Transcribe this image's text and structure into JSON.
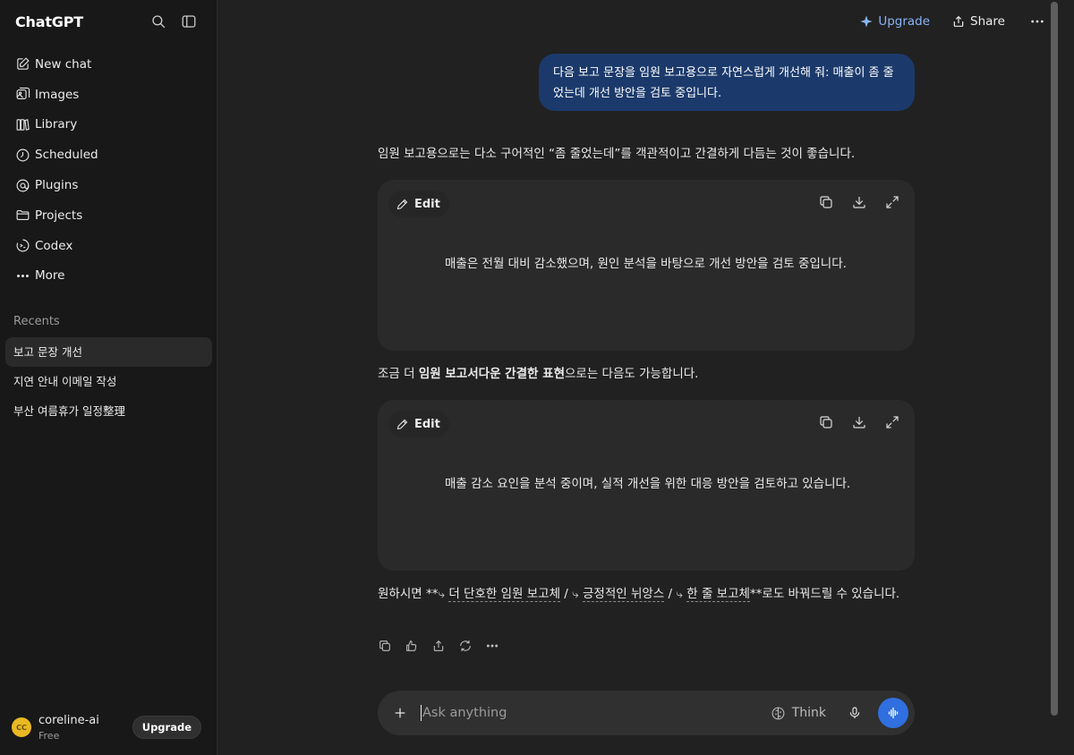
{
  "sidebar": {
    "logo": "ChatGPT",
    "nav": [
      {
        "label": "New chat",
        "icon": "edit-icon"
      },
      {
        "label": "Images",
        "icon": "images-icon"
      },
      {
        "label": "Library",
        "icon": "library-icon"
      },
      {
        "label": "Scheduled",
        "icon": "clock-icon"
      },
      {
        "label": "Plugins",
        "icon": "plugins-icon"
      },
      {
        "label": "Projects",
        "icon": "folder-icon"
      },
      {
        "label": "Codex",
        "icon": "codex-icon"
      },
      {
        "label": "More",
        "icon": "more-icon"
      }
    ],
    "recents_label": "Recents",
    "recents": [
      "보고 문장 개선",
      "지연 안내 이메일 작성",
      "부산 여름휴가 일정整理"
    ],
    "user": {
      "initials": "CC",
      "name": "coreline-ai",
      "plan": "Free",
      "upgrade": "Upgrade"
    }
  },
  "topbar": {
    "upgrade": "Upgrade",
    "share": "Share"
  },
  "conversation": {
    "user_message": "다음 보고 문장을 임원 보고용으로 자연스럽게 개선해 줘: 매출이 좀 줄었는데 개선 방안을 검토 중입니다.",
    "intro": "임원 보고용으로는 다소 구어적인 “좀 줄었는데”를 객관적이고 간결하게 다듬는 것이 좋습니다.",
    "card1": {
      "edit": "Edit",
      "text": "매출은 전월 대비 감소했으며, 원인 분석을 바탕으로 개선 방안을 검토 중입니다."
    },
    "middle_pre": "조금 더 ",
    "middle_bold": "임원 보고서다운 간결한 표현",
    "middle_post": "으로는 다음도 가능합니다.",
    "card2": {
      "edit": "Edit",
      "text": "매출 감소 요인을 분석 중이며, 실적 개선을 위한 대응 방안을 검토하고 있습니다."
    },
    "follow": {
      "pre": "원하시면 **",
      "arrow": "⤷",
      "opt1": "더 단호한 임원 보고체",
      "sep": " / ",
      "opt2": "긍정적인 뉘앙스",
      "opt3": "한 줄 보고체",
      "post": "**로도 바꿔드릴 수 있습니다."
    }
  },
  "composer": {
    "placeholder": "Ask anything",
    "think": "Think"
  },
  "colors": {
    "accent": "#2f6fe0",
    "user_bubble": "#1b3a6b",
    "upgrade": "#8ab4f8"
  }
}
